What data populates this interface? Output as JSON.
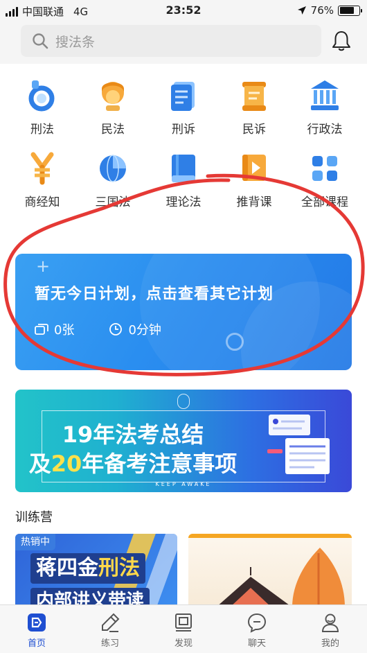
{
  "status_bar": {
    "carrier": "中国联通",
    "network": "4G",
    "time": "23:52",
    "battery": "76%",
    "battery_level": 0.76
  },
  "search": {
    "placeholder": "搜法条"
  },
  "categories": [
    {
      "label": "刑法",
      "icon": "handcuff-icon"
    },
    {
      "label": "民法",
      "icon": "person-icon"
    },
    {
      "label": "刑诉",
      "icon": "document-icon"
    },
    {
      "label": "民诉",
      "icon": "scroll-icon"
    },
    {
      "label": "行政法",
      "icon": "courthouse-icon"
    },
    {
      "label": "商经知",
      "icon": "yen-icon"
    },
    {
      "label": "三国法",
      "icon": "globe-icon"
    },
    {
      "label": "理论法",
      "icon": "book-icon"
    },
    {
      "label": "推背课",
      "icon": "play-icon"
    },
    {
      "label": "全部课程",
      "icon": "grid-icon"
    }
  ],
  "plan_card": {
    "title": "暂无今日计划，点击查看其它计划",
    "cards": "0张",
    "minutes": "0分钟"
  },
  "banner": {
    "line1_prefix": "19",
    "line1_rest": "年法考总结",
    "line2_prefix": "及",
    "line2_highlight": "20",
    "line2_rest": "年备考注意事项",
    "subtitle": "KEEP AWAKE"
  },
  "training": {
    "section_title": "训练营",
    "course1": {
      "badge": "热销中",
      "title_prefix": "蒋四金",
      "title_highlight": "刑法",
      "subtitle": "内部讲义带读"
    }
  },
  "tabbar": [
    {
      "label": "首页",
      "icon": "home-icon",
      "active": true
    },
    {
      "label": "练习",
      "icon": "pencil-icon",
      "active": false
    },
    {
      "label": "发现",
      "icon": "discover-icon",
      "active": false
    },
    {
      "label": "聊天",
      "icon": "chat-icon",
      "active": false
    },
    {
      "label": "我的",
      "icon": "profile-icon",
      "active": false
    }
  ],
  "colors": {
    "accent": "#1f4fd1",
    "plan_blue": "#2a8ef0",
    "highlight_yellow": "#ffe14a",
    "annotation_red": "#e53935"
  }
}
